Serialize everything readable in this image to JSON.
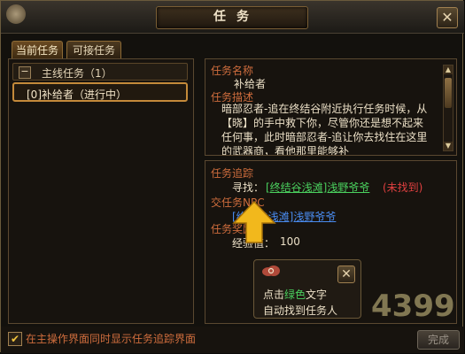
{
  "window": {
    "title": "任务"
  },
  "tabs": [
    {
      "label": "当前任务",
      "active": true
    },
    {
      "label": "可接任务",
      "active": false
    }
  ],
  "quest_list": {
    "group_label": "主线任务（1）",
    "items": [
      {
        "label": "[0]补给者（进行中）",
        "selected": true
      }
    ]
  },
  "quest_detail": {
    "name_label": "任务名称",
    "name_value": "补给者",
    "desc_label": "任务描述",
    "desc_text": "暗部忍者-追在终结谷附近执行任务时候，从【晓】的手中救下你，尽管你还是想不起来任何事，此时暗部忍者-追让你去找住在这里的武器商，看他那里能够补"
  },
  "quest_track": {
    "label": "任务追踪",
    "find_prefix": "寻找：",
    "find_link": "[终结谷浅滩]浅野爷爷",
    "find_status": "(未找到)",
    "npc_label": "交任务NPC",
    "npc_link": "[终结谷浅滩]浅野爷爷",
    "reward_label": "任务奖励",
    "exp_prefix": "经验值：",
    "exp_value": "100"
  },
  "popup": {
    "line1_pre": "点击",
    "line1_green": "绿色",
    "line1_post": "文字",
    "line2": "自动找到任务人"
  },
  "footer": {
    "checkbox_label": "在主操作界面同时显示任务追踪界面",
    "checked": true,
    "finish_button": "完成"
  },
  "watermark": {
    "text": "4399"
  },
  "colors": {
    "accent_red": "#cf6d3d",
    "link_green": "#4ad05e",
    "link_blue": "#4a8cf0",
    "status_red": "#e04040"
  }
}
